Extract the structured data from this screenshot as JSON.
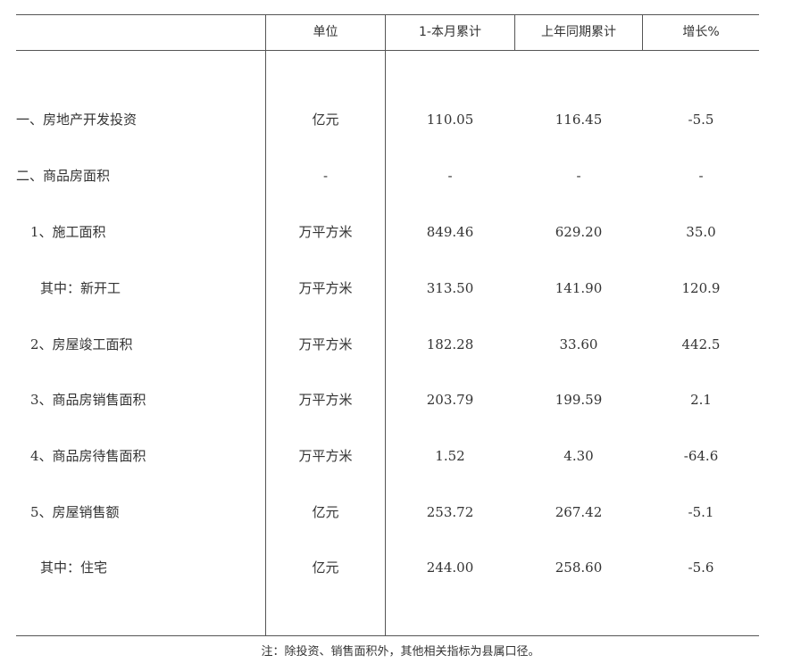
{
  "header": {
    "unit": "单位",
    "current": "1-本月累计",
    "previous": "上年同期累计",
    "growth": "增长%"
  },
  "rows": [
    {
      "label": "一、房地产开发投资",
      "unit": "亿元",
      "current": "110.05",
      "previous": "116.45",
      "growth": "-5.5"
    },
    {
      "label": "二、商品房面积",
      "unit": "-",
      "current": "-",
      "previous": "-",
      "growth": "-"
    },
    {
      "label": "1、施工面积",
      "unit": "万平方米",
      "current": "849.46",
      "previous": "629.20",
      "growth": "35.0"
    },
    {
      "label": "其中：新开工",
      "unit": "万平方米",
      "current": "313.50",
      "previous": "141.90",
      "growth": "120.9"
    },
    {
      "label": "2、房屋竣工面积",
      "unit": "万平方米",
      "current": "182.28",
      "previous": "33.60",
      "growth": "442.5"
    },
    {
      "label": "3、商品房销售面积",
      "unit": "万平方米",
      "current": "203.79",
      "previous": "199.59",
      "growth": "2.1"
    },
    {
      "label": "4、商品房待售面积",
      "unit": "万平方米",
      "current": "1.52",
      "previous": "4.30",
      "growth": "-64.6"
    },
    {
      "label": "5、房屋销售额",
      "unit": "亿元",
      "current": "253.72",
      "previous": "267.42",
      "growth": "-5.1"
    },
    {
      "label": "其中：住宅",
      "unit": "亿元",
      "current": "244.00",
      "previous": "258.60",
      "growth": "-5.6"
    }
  ],
  "note": "注：除投资、销售面积外，其他相关指标为县属口径。"
}
